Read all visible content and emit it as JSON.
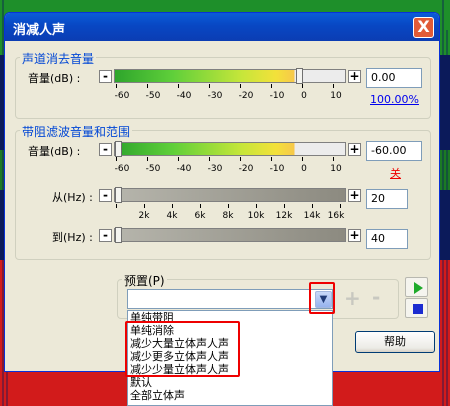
{
  "window": {
    "title": "消减人声",
    "close_glyph": "X"
  },
  "group1": {
    "title": "声道消去音量",
    "label": "音量(dB) :",
    "ticks": [
      "-60",
      "-50",
      "-40",
      "-30",
      "-20",
      "-10",
      "0",
      "10"
    ],
    "value": "0.00",
    "percent_link": "100.00%",
    "level_fraction": 0.78
  },
  "group2": {
    "title": "带阻滤波音量和范围",
    "volume_label": "音量(dB) :",
    "volume_ticks": [
      "-60",
      "-50",
      "-40",
      "-30",
      "-20",
      "-10",
      "0",
      "10"
    ],
    "volume_value": "-60.00",
    "off_link": "关",
    "from_label": "从(Hz) :",
    "from_value": "20",
    "to_label": "到(Hz) :",
    "to_value": "40",
    "freq_ticks": [
      "2k",
      "4k",
      "6k",
      "8k",
      "10k",
      "12k",
      "14k",
      "16k"
    ]
  },
  "preset": {
    "label": "预置(P)",
    "selected": "",
    "options": [
      "单纯带阻",
      "单纯消除",
      "减少大量立体声人声",
      "减少更多立体声人声",
      "减少少量立体声人声",
      "默认",
      "全部立体声"
    ],
    "add_glyph": "+",
    "remove_glyph": "-"
  },
  "buttons": {
    "help": "帮助",
    "cancel": ""
  },
  "icons": {
    "play": "play-icon",
    "stop": "stop-icon",
    "dropdown": "chevron-down-icon"
  },
  "colors": {
    "highlight_box": "#e00000",
    "group_title": "#0046d5"
  }
}
